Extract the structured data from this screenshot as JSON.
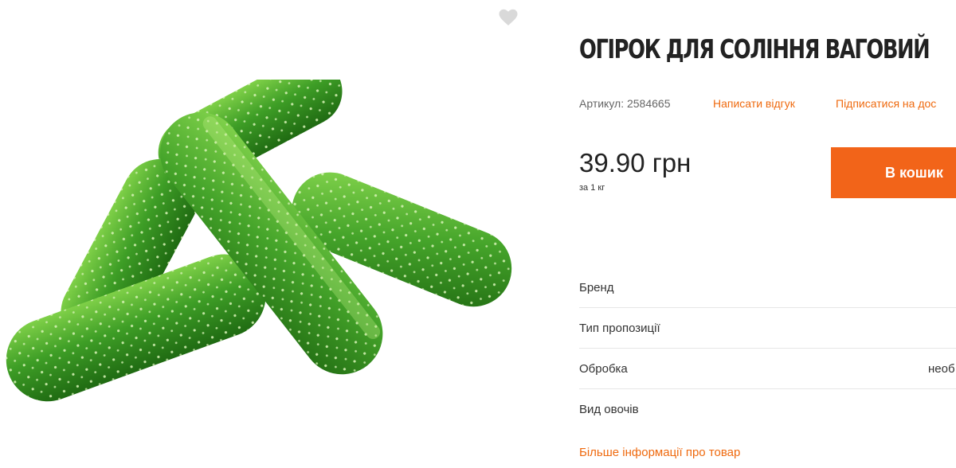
{
  "product": {
    "title": "ОГІРОК ДЛЯ СОЛІННЯ ВАГОВИЙ",
    "image_alt": "cucumbers",
    "sku_label": "Артикул:",
    "sku_value": "2584665",
    "review_link": "Написати відгук",
    "subscribe_link": "Підписатися на дос",
    "price": "39.90 грн",
    "unit": "за 1 кг",
    "cart_button": "В кошик",
    "favorite_icon": "heart-icon"
  },
  "specs": [
    {
      "label": "Бренд",
      "value": ""
    },
    {
      "label": "Тип пропозиції",
      "value": ""
    },
    {
      "label": "Обробка",
      "value": "необ"
    },
    {
      "label": "Вид овочів",
      "value": ""
    }
  ],
  "more_info_link": "Більше інформації про товар",
  "colors": {
    "accent": "#f26419",
    "link": "#ef6a0f",
    "cucumber_dark": "#2f8a1e",
    "cucumber_light": "#6fc23a"
  }
}
